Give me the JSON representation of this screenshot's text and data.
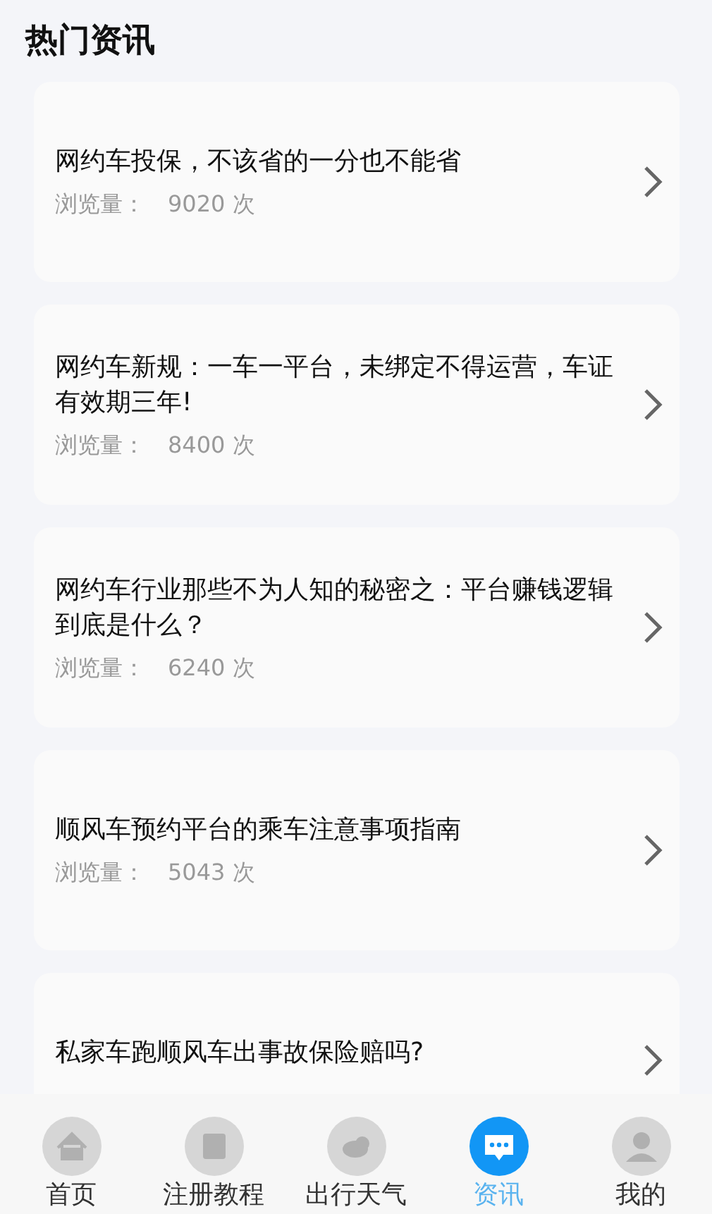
{
  "header": {
    "title": "热门资讯"
  },
  "articles": [
    {
      "title": "网约车投保，不该省的一分也不能省",
      "views_label": "浏览量：",
      "views": "9020 次"
    },
    {
      "title": "网约车新规：一车一平台，未绑定不得运营，车证有效期三年!",
      "views_label": "浏览量：",
      "views": "8400 次"
    },
    {
      "title": "网约车行业那些不为人知的秘密之：平台赚钱逻辑到底是什么？",
      "views_label": "浏览量：",
      "views": "6240 次"
    },
    {
      "title": "顺风车预约平台的乘车注意事项指南",
      "views_label": "浏览量：",
      "views": "5043 次"
    },
    {
      "title": "私家车跑顺风车出事故保险赔吗?"
    }
  ],
  "tab_bar": [
    {
      "kind": "home",
      "label": "首页",
      "selected": false
    },
    {
      "kind": "book",
      "label": "注册教程",
      "selected": false
    },
    {
      "kind": "weather",
      "label": "出行天气",
      "selected": false
    },
    {
      "kind": "chat",
      "label": "资讯",
      "selected": true
    },
    {
      "kind": "profile",
      "label": "我的",
      "selected": false
    }
  ]
}
